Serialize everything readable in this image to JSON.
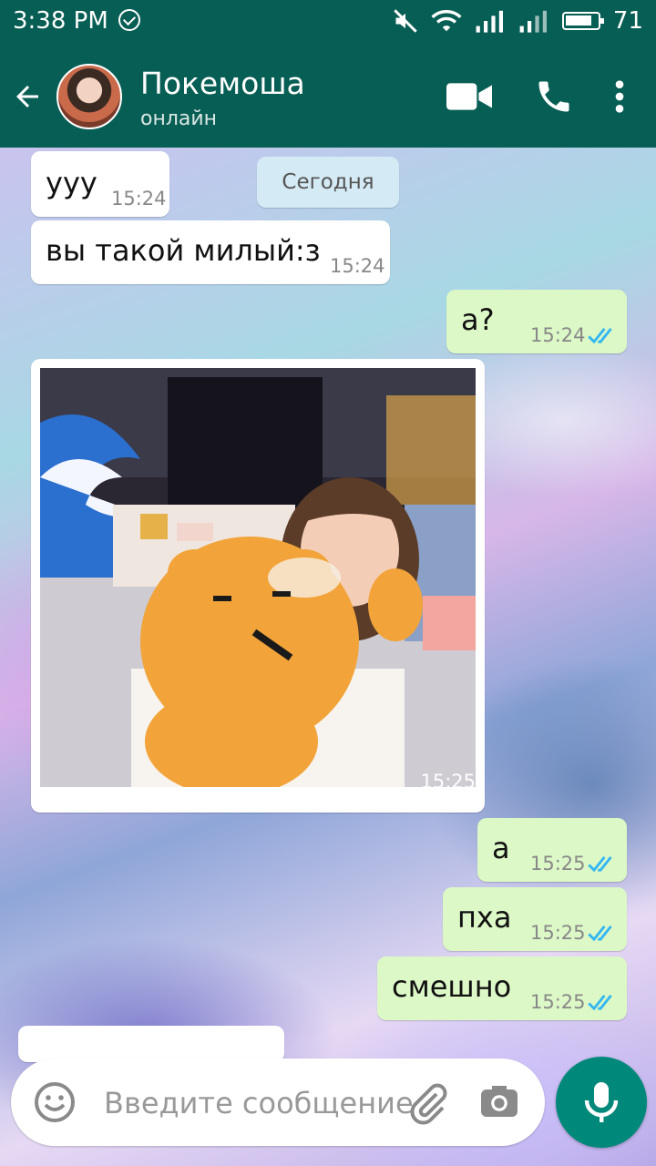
{
  "status_bar": {
    "time": "3:38 PM",
    "battery": "71"
  },
  "header": {
    "contact_name": "Покемоша",
    "contact_status": "онлайн"
  },
  "date_chip": "Сегодня",
  "messages": [
    {
      "text": "ууу",
      "time": "15:24"
    },
    {
      "text": "вы такой милый:з",
      "time": "15:24"
    },
    {
      "text": "а?",
      "time": "15:24"
    },
    {
      "time": "15:25"
    },
    {
      "text": "а",
      "time": "15:25"
    },
    {
      "text": "пха",
      "time": "15:25"
    },
    {
      "text": "смешно",
      "time": "15:25"
    }
  ],
  "input": {
    "placeholder": "Введите сообщение"
  },
  "colors": {
    "header": "#075E54",
    "outgoing_bubble": "#DCF8C6",
    "incoming_bubble": "#FFFFFF",
    "read_ticks": "#34B7F1",
    "mic_button": "#00897B"
  },
  "icons": [
    "back-arrow-icon",
    "video-call-icon",
    "phone-icon",
    "more-vert-icon",
    "emoji-icon",
    "attach-icon",
    "camera-icon",
    "mic-icon"
  ]
}
